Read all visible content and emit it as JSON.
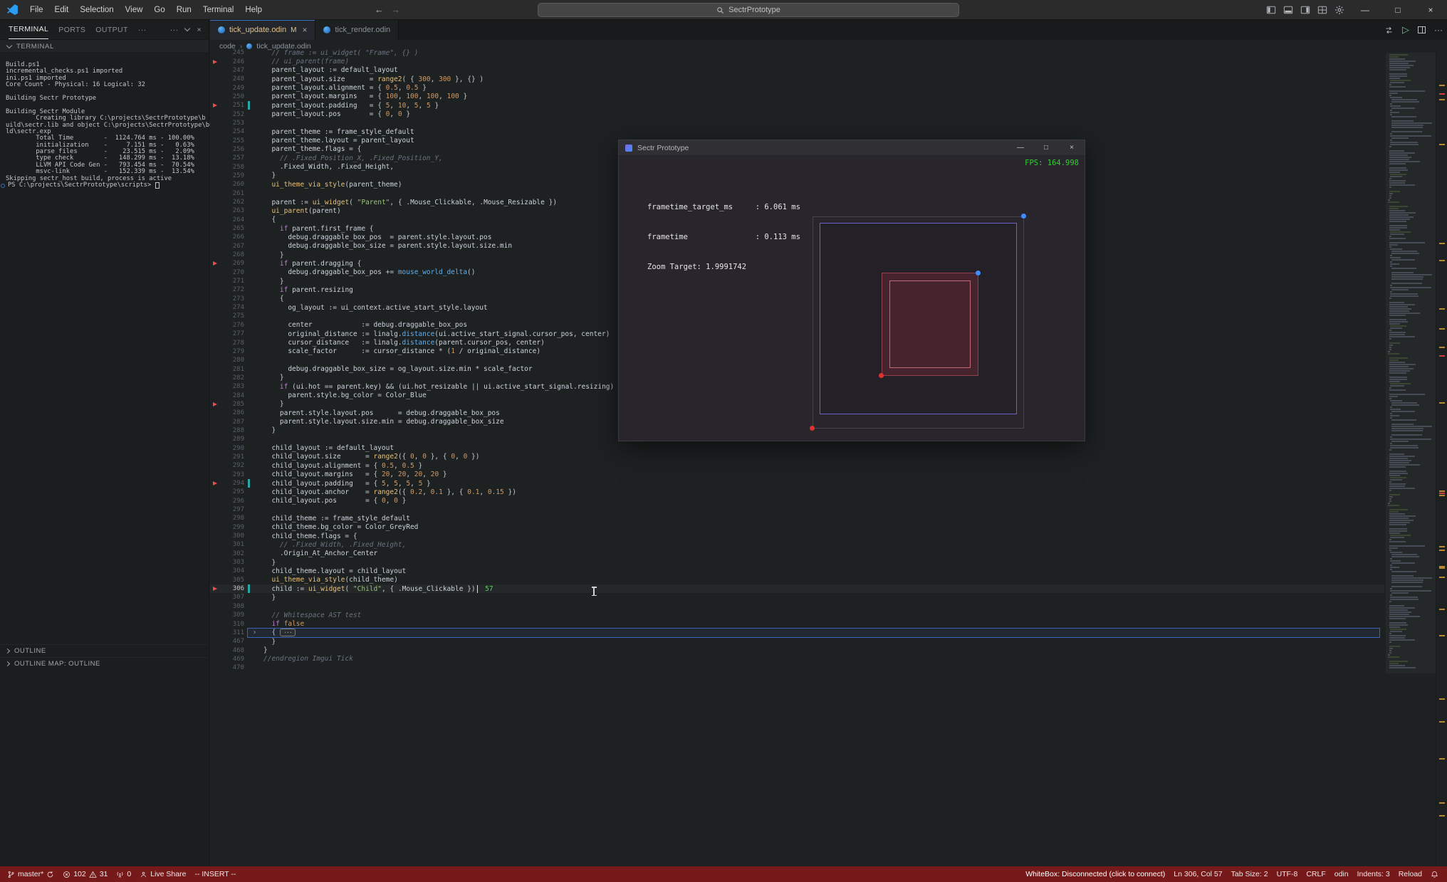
{
  "colors": {
    "statusbar_bg": "#75191a",
    "accent_blue": "#3b76c4",
    "modified_tab": "#e2c08d",
    "error_red": "#f14c4c",
    "change_teal": "#2aa7a7",
    "fps_green": "#2fd32f",
    "parent_border": "#6c5fce",
    "child_fill": "#46242e",
    "child_border": "#93404e",
    "child_inner_border": "#c06a78",
    "dot_blue": "#3f8cff",
    "dot_red": "#e03131"
  },
  "icons": {
    "close": "×",
    "minimize": "—",
    "maximize": "□",
    "play": "▷",
    "ellipsis": "···",
    "chevron_right": "›",
    "back_arrow": "←",
    "forward_arrow": "→"
  },
  "titlebar": {
    "menus": [
      "File",
      "Edit",
      "Selection",
      "View",
      "Go",
      "Run",
      "Terminal",
      "Help"
    ],
    "search": "SectrPrototype"
  },
  "panel": {
    "tabs": [
      "TERMINAL",
      "PORTS",
      "OUTPUT"
    ],
    "section": "TERMINAL",
    "terminal_lines": [
      "Build.ps1",
      "incremental_checks.ps1 imported",
      "ini.ps1 imported",
      "Core Count - Physical: 16 Logical: 32",
      "",
      "Building Sectr Prototype",
      "",
      "Building Sectr Module",
      "        Creating library C:\\projects\\SectrPrototype\\b",
      "uild\\sectr.lib and object C:\\projects\\SectrPrototype\\bui",
      "ld\\sectr.exp",
      "        Total Time        -  1124.764 ms - 100.00%",
      "        initialization    -     7.151 ms -   0.63%",
      "        parse files       -    23.515 ms -   2.09%",
      "        type check        -   148.299 ms -  13.18%",
      "        LLVM API Code Gen -   793.454 ms -  70.54%",
      "        msvc-link         -   152.339 ms -  13.54%",
      "Skipping sectr_host build, process is active"
    ],
    "prompt": "PS C:\\projects\\SectrPrototype\\scripts>",
    "bottom_sections": [
      "OUTLINE",
      "OUTLINE MAP: OUTLINE"
    ]
  },
  "editor": {
    "tabs": [
      {
        "label": "tick_update.odin",
        "badge": "M"
      },
      {
        "label": "tick_render.odin",
        "badge": ""
      }
    ],
    "breadcrumb": [
      "code",
      "tick_update.odin"
    ],
    "current_line": 306,
    "cursor_hint": "57",
    "folded_line": 311,
    "red_markers": [
      246,
      251,
      269,
      285,
      294,
      306
    ],
    "change_bars": [
      251,
      294,
      306
    ],
    "lines": [
      {
        "n": 245,
        "t": "  // frame := ui_widget( \"Frame\", {} )"
      },
      {
        "n": 246,
        "t": "  // ui_parent(frame)"
      },
      {
        "n": 247,
        "t": "  parent_layout := default_layout"
      },
      {
        "n": 248,
        "t": "  parent_layout.size      = range2( { 300, 300 }, {} )"
      },
      {
        "n": 249,
        "t": "  parent_layout.alignment = { 0.5, 0.5 }"
      },
      {
        "n": 250,
        "t": "  parent_layout.margins   = { 100, 100, 100, 100 }"
      },
      {
        "n": 251,
        "t": "  parent_layout.padding   = { 5, 10, 5, 5 }"
      },
      {
        "n": 252,
        "t": "  parent_layout.pos       = { 0, 0 }"
      },
      {
        "n": 253,
        "t": ""
      },
      {
        "n": 254,
        "t": "  parent_theme := frame_style_default"
      },
      {
        "n": 255,
        "t": "  parent_theme.layout = parent_layout"
      },
      {
        "n": 256,
        "t": "  parent_theme.flags = {"
      },
      {
        "n": 257,
        "t": "    // .Fixed_Position_X, .Fixed_Position_Y,"
      },
      {
        "n": 258,
        "t": "    .Fixed_Width, .Fixed_Height,"
      },
      {
        "n": 259,
        "t": "  }"
      },
      {
        "n": 260,
        "t": "  ui_theme_via_style(parent_theme)"
      },
      {
        "n": 261,
        "t": ""
      },
      {
        "n": 262,
        "t": "  parent := ui_widget( \"Parent\", { .Mouse_Clickable, .Mouse_Resizable })"
      },
      {
        "n": 263,
        "t": "  ui_parent(parent)"
      },
      {
        "n": 264,
        "t": "  {"
      },
      {
        "n": 265,
        "t": "    if parent.first_frame {"
      },
      {
        "n": 266,
        "t": "      debug.draggable_box_pos  = parent.style.layout.pos"
      },
      {
        "n": 267,
        "t": "      debug.draggable_box_size = parent.style.layout.size.min"
      },
      {
        "n": 268,
        "t": "    }"
      },
      {
        "n": 269,
        "t": "    if parent.dragging {"
      },
      {
        "n": 270,
        "t": "      debug.draggable_box_pos += mouse_world_delta()"
      },
      {
        "n": 271,
        "t": "    }"
      },
      {
        "n": 272,
        "t": "    if parent.resizing"
      },
      {
        "n": 273,
        "t": "    {"
      },
      {
        "n": 274,
        "t": "      og_layout := ui_context.active_start_style.layout"
      },
      {
        "n": 275,
        "t": ""
      },
      {
        "n": 276,
        "t": "      center            := debug.draggable_box_pos"
      },
      {
        "n": 277,
        "t": "      original_distance := linalg.distance(ui.active_start_signal.cursor_pos, center)"
      },
      {
        "n": 278,
        "t": "      cursor_distance   := linalg.distance(parent.cursor_pos, center)"
      },
      {
        "n": 279,
        "t": "      scale_factor      := cursor_distance * (1 / original_distance)"
      },
      {
        "n": 280,
        "t": ""
      },
      {
        "n": 281,
        "t": "      debug.draggable_box_size = og_layout.size.min * scale_factor"
      },
      {
        "n": 282,
        "t": "    }"
      },
      {
        "n": 283,
        "t": "    if (ui.hot == parent.key) && (ui.hot_resizable || ui.active_start_signal.resizing) {"
      },
      {
        "n": 284,
        "t": "      parent.style.bg_color = Color_Blue"
      },
      {
        "n": 285,
        "t": "    }"
      },
      {
        "n": 286,
        "t": "    parent.style.layout.pos      = debug.draggable_box_pos"
      },
      {
        "n": 287,
        "t": "    parent.style.layout.size.min = debug.draggable_box_size"
      },
      {
        "n": 288,
        "t": "  }"
      },
      {
        "n": 289,
        "t": ""
      },
      {
        "n": 290,
        "t": "  child_layout := default_layout"
      },
      {
        "n": 291,
        "t": "  child_layout.size      = range2({ 0, 0 }, { 0, 0 })"
      },
      {
        "n": 292,
        "t": "  child_layout.alignment = { 0.5, 0.5 }"
      },
      {
        "n": 293,
        "t": "  child_layout.margins   = { 20, 20, 20, 20 }"
      },
      {
        "n": 294,
        "t": "  child_layout.padding   = { 5, 5, 5, 5 }"
      },
      {
        "n": 295,
        "t": "  child_layout.anchor    = range2({ 0.2, 0.1 }, { 0.1, 0.15 })"
      },
      {
        "n": 296,
        "t": "  child_layout.pos       = { 0, 0 }"
      },
      {
        "n": 297,
        "t": ""
      },
      {
        "n": 298,
        "t": "  child_theme := frame_style_default"
      },
      {
        "n": 299,
        "t": "  child_theme.bg_color = Color_GreyRed"
      },
      {
        "n": 300,
        "t": "  child_theme.flags = {"
      },
      {
        "n": 301,
        "t": "    // .Fixed_Width, .Fixed_Height,"
      },
      {
        "n": 302,
        "t": "    .Origin_At_Anchor_Center"
      },
      {
        "n": 303,
        "t": "  }"
      },
      {
        "n": 304,
        "t": "  child_theme.layout = child_layout"
      },
      {
        "n": 305,
        "t": "  ui_theme_via_style(child_theme)"
      },
      {
        "n": 306,
        "t": "  child := ui_widget( \"Child\", { .Mouse_Clickable })"
      },
      {
        "n": 307,
        "t": "  }"
      },
      {
        "n": 308,
        "t": ""
      },
      {
        "n": 309,
        "t": "  // Whitespace AST test"
      },
      {
        "n": 310,
        "t": "  if false"
      },
      {
        "n": 311,
        "t": "  {"
      },
      {
        "n": 467,
        "t": "  }"
      },
      {
        "n": 468,
        "t": "}"
      },
      {
        "n": 469,
        "t": "//endregion Imgui Tick"
      },
      {
        "n": 470,
        "t": ""
      }
    ]
  },
  "overlay": {
    "title": "Sectr Prototype",
    "fps": "FPS: 164.998",
    "stats": [
      "frametime_target_ms     : 6.061 ms",
      "frametime               : 0.113 ms",
      "Zoom Target: 1.9991742"
    ]
  },
  "statusbar": {
    "branch": "master*",
    "errors": "102",
    "warnings": "31",
    "ports": "0",
    "live_share": "Live Share",
    "mode": "-- INSERT --",
    "whitebox": "WhiteBox: Disconnected (click to connect)",
    "position": "Ln 306, Col 57",
    "tab_size": "Tab Size: 2",
    "encoding": "UTF-8",
    "eol": "CRLF",
    "language": "odin",
    "indents": "Indents: 3",
    "reload": "Reload"
  }
}
